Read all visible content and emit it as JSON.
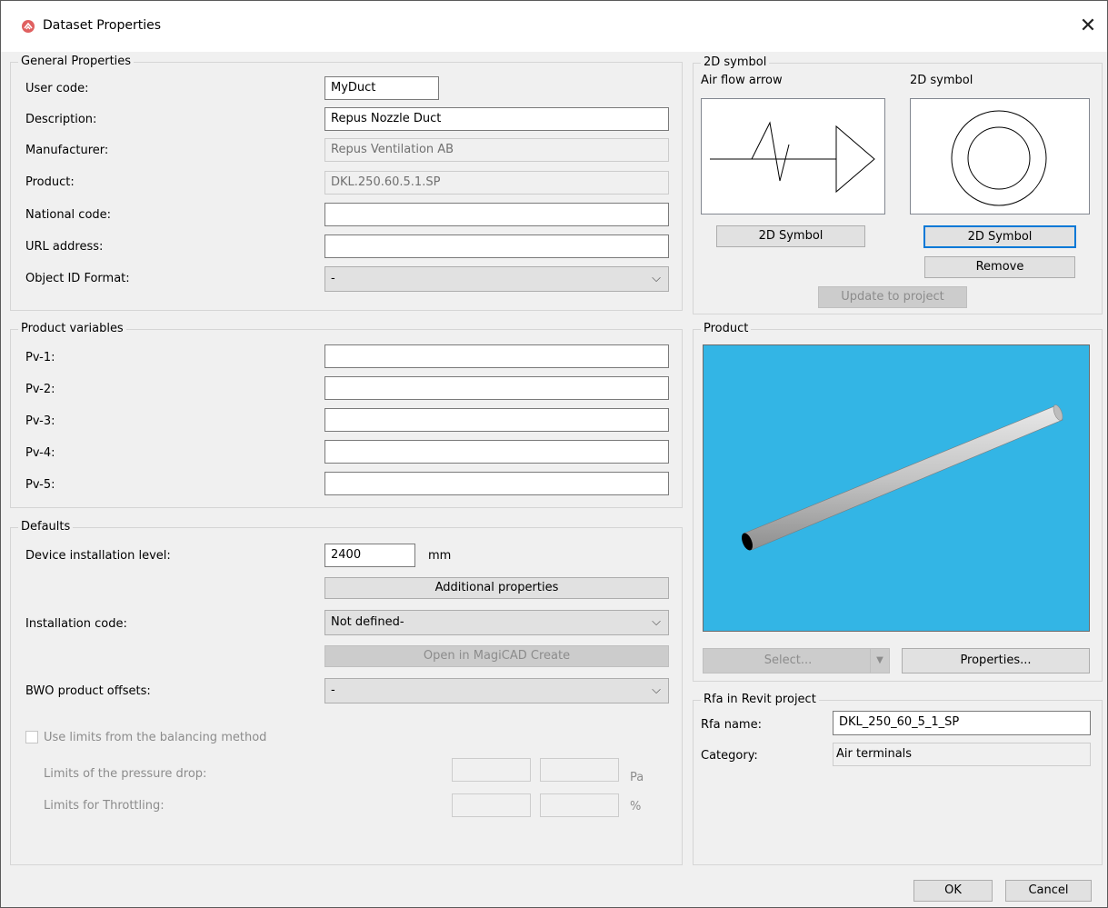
{
  "window": {
    "title": "Dataset Properties"
  },
  "general": {
    "legend": "General Properties",
    "user_code_label": "User code:",
    "user_code_value": "MyDuct",
    "description_label": "Description:",
    "description_value": "Repus Nozzle Duct",
    "manufacturer_label": "Manufacturer:",
    "manufacturer_value": "Repus Ventilation AB",
    "product_label": "Product:",
    "product_value": "DKL.250.60.5.1.SP",
    "national_code_label": "National code:",
    "national_code_value": "",
    "url_label": "URL address:",
    "url_value": "",
    "object_id_label": "Object ID Format:",
    "object_id_value": "-"
  },
  "product_variables": {
    "legend": "Product variables",
    "items": [
      {
        "label": "Pv-1:",
        "value": ""
      },
      {
        "label": "Pv-2:",
        "value": ""
      },
      {
        "label": "Pv-3:",
        "value": ""
      },
      {
        "label": "Pv-4:",
        "value": ""
      },
      {
        "label": "Pv-5:",
        "value": ""
      }
    ]
  },
  "defaults": {
    "legend": "Defaults",
    "install_level_label": "Device installation level:",
    "install_level_value": "2400",
    "install_level_unit": "mm",
    "additional_properties_button": "Additional properties",
    "installation_code_label": "Installation code:",
    "installation_code_value": "Not defined-",
    "open_magicad_button": "Open in MagiCAD Create",
    "bwo_label": "BWO product offsets:",
    "bwo_value": "-",
    "use_limits_label": "Use limits from the balancing method",
    "pressure_drop_label": "Limits of the pressure drop:",
    "pressure_drop_unit": "Pa",
    "throttling_label": "Limits for Throttling:",
    "throttling_unit": "%"
  },
  "symbol2d": {
    "legend": "2D symbol",
    "airflow_label": "Air flow arrow",
    "symbol_label": "2D symbol",
    "airflow_button": "2D Symbol",
    "symbol_button": "2D Symbol",
    "remove_button": "Remove",
    "update_button": "Update to project"
  },
  "product": {
    "legend": "Product",
    "viewport_color": "#33b5e5",
    "select_button": "Select...",
    "properties_button": "Properties..."
  },
  "rfa": {
    "legend": "Rfa in Revit project",
    "name_label": "Rfa name:",
    "name_value": "DKL_250_60_5_1_SP",
    "category_label": "Category:",
    "category_value": "Air terminals"
  },
  "footer": {
    "ok_button": "OK",
    "cancel_button": "Cancel"
  }
}
